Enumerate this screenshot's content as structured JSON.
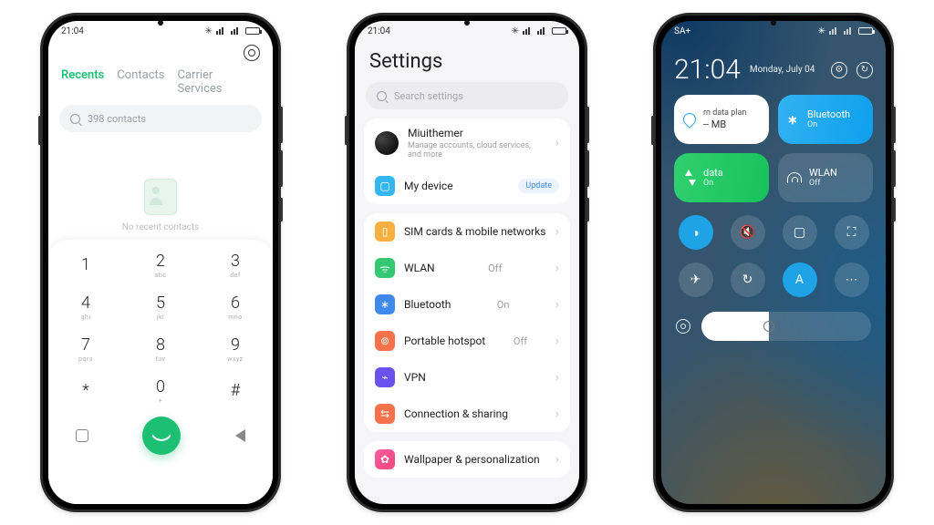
{
  "p1": {
    "status_time": "21:04",
    "tabs": [
      "Recents",
      "Contacts",
      "Carrier Services"
    ],
    "search_placeholder": "398 contacts",
    "empty": "No recent contacts",
    "keys": [
      {
        "d": "1",
        "l": ""
      },
      {
        "d": "2",
        "l": "abc"
      },
      {
        "d": "3",
        "l": "def"
      },
      {
        "d": "4",
        "l": "ghi"
      },
      {
        "d": "5",
        "l": "jkl"
      },
      {
        "d": "6",
        "l": "mno"
      },
      {
        "d": "7",
        "l": "pqrs"
      },
      {
        "d": "8",
        "l": "tuv"
      },
      {
        "d": "9",
        "l": "wxyz"
      },
      {
        "d": "*",
        "l": ""
      },
      {
        "d": "0",
        "l": "+"
      },
      {
        "d": "#",
        "l": ""
      }
    ]
  },
  "p2": {
    "status_time": "21:04",
    "title": "Settings",
    "search_placeholder": "Search settings",
    "account": {
      "name": "Miuithemer",
      "sub": "Manage accounts, cloud services, and more"
    },
    "my_device": {
      "label": "My device",
      "badge": "Update"
    },
    "net": {
      "sim": "SIM cards & mobile networks",
      "wlan": {
        "label": "WLAN",
        "status": "Off"
      },
      "bt": {
        "label": "Bluetooth",
        "status": "On"
      },
      "hs": {
        "label": "Portable hotspot",
        "status": "Off"
      },
      "vpn": "VPN",
      "cs": "Connection & sharing"
    },
    "wp": "Wallpaper & personalization"
  },
  "p3": {
    "status_left": "SA+",
    "time": "21:04",
    "date": "Monday, July 04",
    "tiles": {
      "data": {
        "top": "rn data plan",
        "sub": "-- MB"
      },
      "bt": {
        "label": "Bluetooth",
        "sub": "On"
      },
      "mobile": {
        "label": "data",
        "sub": "On"
      },
      "wlan": {
        "label": "WLAN",
        "sub": "Off"
      }
    },
    "qbtns": [
      "flashlight",
      "mute",
      "rotate",
      "screenshot",
      "airplane",
      "sync",
      "font",
      "more"
    ]
  }
}
